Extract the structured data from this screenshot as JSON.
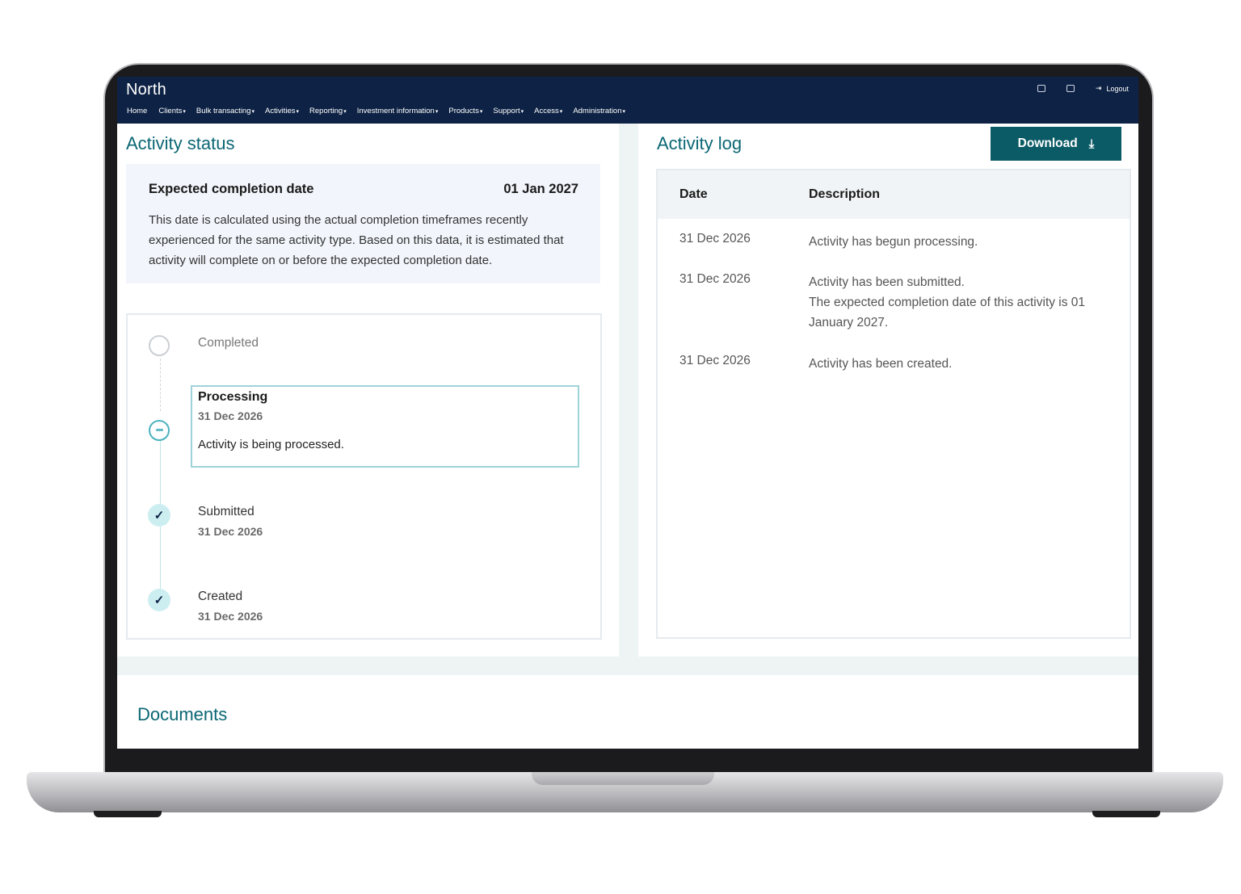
{
  "app": {
    "logo": "North",
    "nav": [
      {
        "label": "Home",
        "caret": ""
      },
      {
        "label": "Clients",
        "caret": "▾"
      },
      {
        "label": "Bulk transacting",
        "caret": "▾"
      },
      {
        "label": "Activities",
        "caret": "▾"
      },
      {
        "label": "Reporting",
        "caret": "▾"
      },
      {
        "label": "Investment information",
        "caret": "▾"
      },
      {
        "label": "Products",
        "caret": "▾"
      },
      {
        "label": "Support",
        "caret": "▾"
      },
      {
        "label": "Access",
        "caret": "▾"
      },
      {
        "label": "Administration",
        "caret": "▾"
      }
    ],
    "logout_label": "Logout",
    "colors": {
      "nav_bg": "#0d2244",
      "accent": "#0b6774",
      "button": "#0b5b66"
    }
  },
  "activity_status": {
    "title": "Activity status",
    "expected_label": "Expected completion date",
    "expected_date": "01 Jan 2027",
    "explanation": "This date is calculated using the actual completion timeframes recently experienced for the same activity type. Based on this data, it is estimated that activity will complete on or before the expected completion date.",
    "steps": {
      "completed": {
        "label": "Completed"
      },
      "processing": {
        "label": "Processing",
        "date": "31 Dec 2026",
        "description": "Activity is being processed."
      },
      "submitted": {
        "label": "Submitted",
        "date": "31 Dec 2026"
      },
      "created": {
        "label": "Created",
        "date": "31 Dec 2026"
      }
    }
  },
  "activity_log": {
    "title": "Activity log",
    "download_label": "Download",
    "columns": {
      "date": "Date",
      "description": "Description"
    },
    "rows": [
      {
        "date": "31 Dec 2026",
        "description": "Activity has begun processing."
      },
      {
        "date": "31 Dec 2026",
        "description": "Activity has been submitted.\nThe expected completion date of this activity is 01 January 2027."
      },
      {
        "date": "31 Dec 2026",
        "description": "Activity has been created."
      }
    ]
  },
  "documents": {
    "title": "Documents"
  }
}
